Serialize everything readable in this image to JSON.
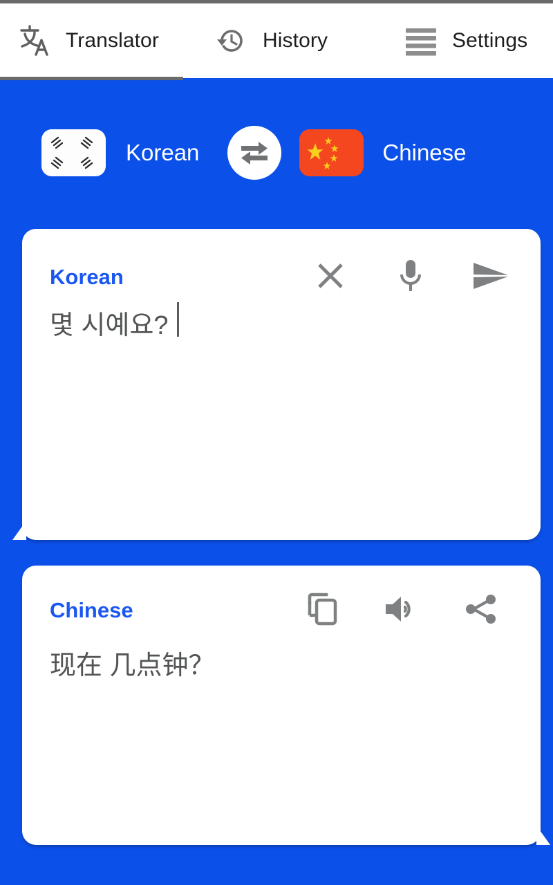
{
  "theme": {
    "background_blue": "#0c50ea",
    "card_white": "#ffffff",
    "accent_blue": "#1a56f0",
    "icon_gray": "#7b7b7b",
    "text_gray": "#525455",
    "tab_indicator": "#6b6b6b"
  },
  "tabs": [
    {
      "id": "translator",
      "label": "Translator",
      "icon": "translate-icon",
      "active": true
    },
    {
      "id": "history",
      "label": "History",
      "icon": "history-clock-icon",
      "active": false
    },
    {
      "id": "settings",
      "label": "Settings",
      "icon": "hamburger-menu-icon",
      "active": false
    }
  ],
  "language_bar": {
    "source": {
      "name": "Korean",
      "flag": "south-korea-flag"
    },
    "target": {
      "name": "Chinese",
      "flag": "china-flag"
    },
    "swap_button": {
      "icon": "swap-arrows-icon",
      "label": ""
    }
  },
  "input_card": {
    "language_label": "Korean",
    "text": "몇 시예요?",
    "has_cursor": true,
    "actions": [
      {
        "id": "clear",
        "icon": "close-x-icon"
      },
      {
        "id": "voice",
        "icon": "microphone-icon"
      },
      {
        "id": "translate",
        "icon": "send-icon"
      }
    ]
  },
  "output_card": {
    "language_label": "Chinese",
    "text": "现在 几点钟？",
    "actions": [
      {
        "id": "copy",
        "icon": "copy-icon"
      },
      {
        "id": "speak",
        "icon": "speaker-volume-icon"
      },
      {
        "id": "share",
        "icon": "share-icon"
      }
    ]
  }
}
